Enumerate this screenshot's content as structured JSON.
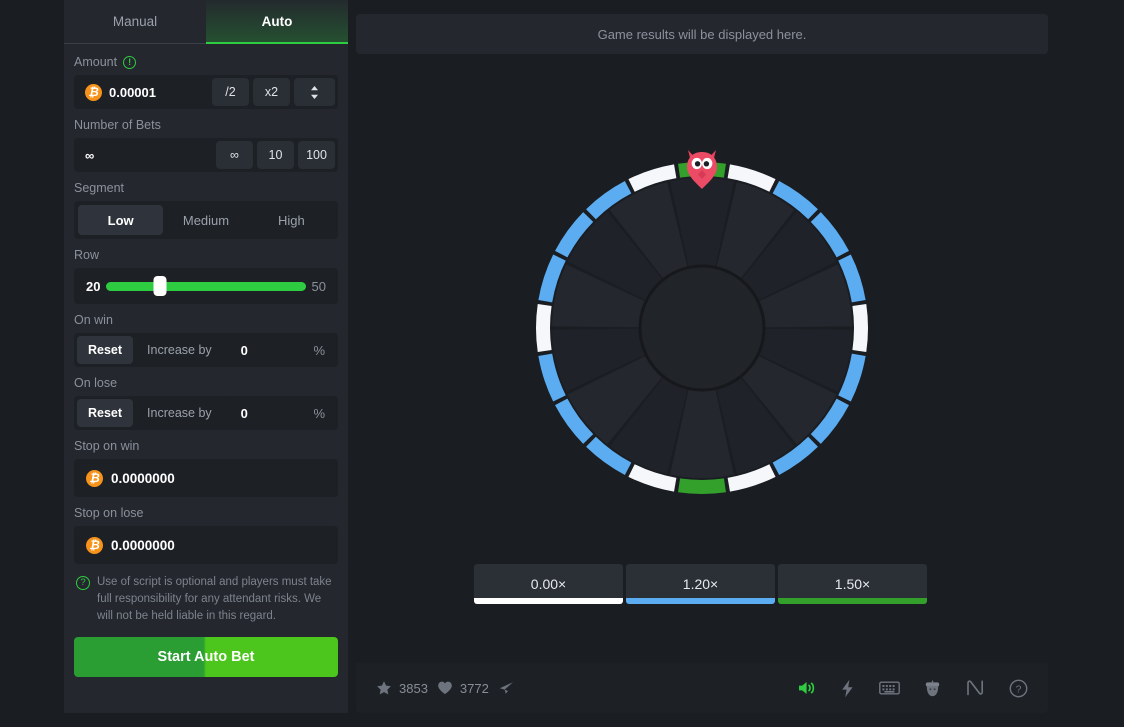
{
  "tabs": [
    {
      "label": "Manual",
      "active": false
    },
    {
      "label": "Auto",
      "active": true
    }
  ],
  "sidebar": {
    "amount": {
      "label": "Amount",
      "info_icon": "info-exclamation-icon",
      "currency_icon": "bitcoin-icon",
      "value": "0.00001",
      "buttons": [
        "/2",
        "x2"
      ],
      "stepper_icon": "up-down-chevron-icon"
    },
    "number_of_bets": {
      "label": "Number of Bets",
      "value": "∞",
      "buttons": [
        "∞",
        "10",
        "100"
      ]
    },
    "segment": {
      "label": "Segment",
      "options": [
        "Low",
        "Medium",
        "High"
      ],
      "selected": "Low"
    },
    "row": {
      "label": "Row",
      "min": "20",
      "max": "50",
      "value": 20,
      "fill_percent": 100,
      "thumb_percent": 27
    },
    "on_win": {
      "label": "On win",
      "reset_label": "Reset",
      "increase_label": "Increase by",
      "selected": "Reset",
      "percent_value": "0",
      "percent_symbol": "%"
    },
    "on_lose": {
      "label": "On lose",
      "reset_label": "Reset",
      "increase_label": "Increase by",
      "selected": "Reset",
      "percent_value": "0",
      "percent_symbol": "%"
    },
    "stop_on_win": {
      "label": "Stop on win",
      "currency_icon": "bitcoin-icon",
      "value": "0.0000000"
    },
    "stop_on_lose": {
      "label": "Stop on lose",
      "currency_icon": "bitcoin-icon",
      "value": "0.0000000"
    },
    "disclaimer": {
      "icon": "question-circle-icon",
      "text": "Use of script is optional and players must take full responsibility for any attendant risks. We will not be held liable in this regard."
    },
    "start_button": "Start Auto Bet"
  },
  "main": {
    "results_placeholder": "Game results will be displayed here.",
    "pointer_icon": "owl-pointer-icon",
    "multipliers": [
      {
        "label": "0.00×",
        "color": "#ffffff"
      },
      {
        "label": "1.20×",
        "color": "#5bacf0"
      },
      {
        "label": "1.50×",
        "color": "#33a02c"
      }
    ]
  },
  "wheel": {
    "segment_count": 20,
    "spoke_count": 14,
    "colors": {
      "blue": "#5bacf0",
      "white": "#f5f7fa",
      "green": "#33a02c"
    },
    "ring_sequence": [
      "green",
      "white",
      "blue",
      "blue",
      "blue",
      "white",
      "blue",
      "blue",
      "blue",
      "white",
      "green",
      "white",
      "blue",
      "blue",
      "blue",
      "white",
      "blue",
      "blue",
      "blue",
      "white"
    ]
  },
  "footer": {
    "star_icon": "star-icon",
    "star_count": "3853",
    "heart_icon": "heart-icon",
    "heart_count": "3772",
    "share_icon": "share-icon",
    "right_icons": [
      {
        "name": "sound-on-icon",
        "active": true
      },
      {
        "name": "lightning-bolt-icon",
        "active": false
      },
      {
        "name": "keyboard-icon",
        "active": false
      },
      {
        "name": "acorn-icon",
        "active": false
      },
      {
        "name": "stats-curve-icon",
        "active": false
      },
      {
        "name": "help-circle-icon",
        "active": false
      }
    ],
    "active_color": "#2ecc40"
  }
}
